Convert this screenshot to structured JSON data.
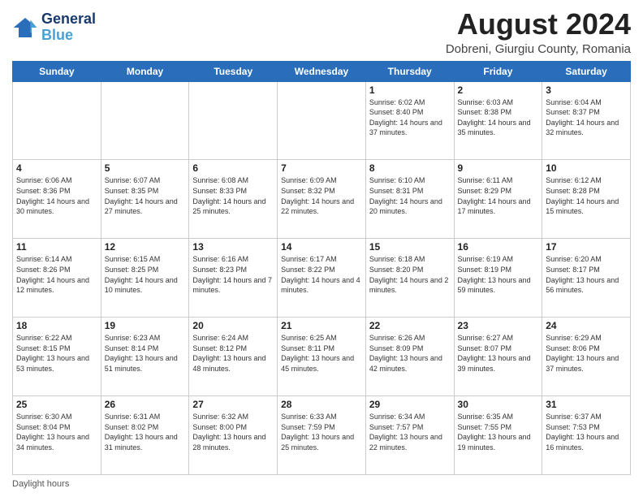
{
  "logo": {
    "line1": "General",
    "line2": "Blue"
  },
  "title": "August 2024",
  "location": "Dobreni, Giurgiu County, Romania",
  "days_of_week": [
    "Sunday",
    "Monday",
    "Tuesday",
    "Wednesday",
    "Thursday",
    "Friday",
    "Saturday"
  ],
  "footer_text": "Daylight hours",
  "weeks": [
    [
      {
        "day": "",
        "info": ""
      },
      {
        "day": "",
        "info": ""
      },
      {
        "day": "",
        "info": ""
      },
      {
        "day": "",
        "info": ""
      },
      {
        "day": "1",
        "info": "Sunrise: 6:02 AM\nSunset: 8:40 PM\nDaylight: 14 hours and 37 minutes."
      },
      {
        "day": "2",
        "info": "Sunrise: 6:03 AM\nSunset: 8:38 PM\nDaylight: 14 hours and 35 minutes."
      },
      {
        "day": "3",
        "info": "Sunrise: 6:04 AM\nSunset: 8:37 PM\nDaylight: 14 hours and 32 minutes."
      }
    ],
    [
      {
        "day": "4",
        "info": "Sunrise: 6:06 AM\nSunset: 8:36 PM\nDaylight: 14 hours and 30 minutes."
      },
      {
        "day": "5",
        "info": "Sunrise: 6:07 AM\nSunset: 8:35 PM\nDaylight: 14 hours and 27 minutes."
      },
      {
        "day": "6",
        "info": "Sunrise: 6:08 AM\nSunset: 8:33 PM\nDaylight: 14 hours and 25 minutes."
      },
      {
        "day": "7",
        "info": "Sunrise: 6:09 AM\nSunset: 8:32 PM\nDaylight: 14 hours and 22 minutes."
      },
      {
        "day": "8",
        "info": "Sunrise: 6:10 AM\nSunset: 8:31 PM\nDaylight: 14 hours and 20 minutes."
      },
      {
        "day": "9",
        "info": "Sunrise: 6:11 AM\nSunset: 8:29 PM\nDaylight: 14 hours and 17 minutes."
      },
      {
        "day": "10",
        "info": "Sunrise: 6:12 AM\nSunset: 8:28 PM\nDaylight: 14 hours and 15 minutes."
      }
    ],
    [
      {
        "day": "11",
        "info": "Sunrise: 6:14 AM\nSunset: 8:26 PM\nDaylight: 14 hours and 12 minutes."
      },
      {
        "day": "12",
        "info": "Sunrise: 6:15 AM\nSunset: 8:25 PM\nDaylight: 14 hours and 10 minutes."
      },
      {
        "day": "13",
        "info": "Sunrise: 6:16 AM\nSunset: 8:23 PM\nDaylight: 14 hours and 7 minutes."
      },
      {
        "day": "14",
        "info": "Sunrise: 6:17 AM\nSunset: 8:22 PM\nDaylight: 14 hours and 4 minutes."
      },
      {
        "day": "15",
        "info": "Sunrise: 6:18 AM\nSunset: 8:20 PM\nDaylight: 14 hours and 2 minutes."
      },
      {
        "day": "16",
        "info": "Sunrise: 6:19 AM\nSunset: 8:19 PM\nDaylight: 13 hours and 59 minutes."
      },
      {
        "day": "17",
        "info": "Sunrise: 6:20 AM\nSunset: 8:17 PM\nDaylight: 13 hours and 56 minutes."
      }
    ],
    [
      {
        "day": "18",
        "info": "Sunrise: 6:22 AM\nSunset: 8:15 PM\nDaylight: 13 hours and 53 minutes."
      },
      {
        "day": "19",
        "info": "Sunrise: 6:23 AM\nSunset: 8:14 PM\nDaylight: 13 hours and 51 minutes."
      },
      {
        "day": "20",
        "info": "Sunrise: 6:24 AM\nSunset: 8:12 PM\nDaylight: 13 hours and 48 minutes."
      },
      {
        "day": "21",
        "info": "Sunrise: 6:25 AM\nSunset: 8:11 PM\nDaylight: 13 hours and 45 minutes."
      },
      {
        "day": "22",
        "info": "Sunrise: 6:26 AM\nSunset: 8:09 PM\nDaylight: 13 hours and 42 minutes."
      },
      {
        "day": "23",
        "info": "Sunrise: 6:27 AM\nSunset: 8:07 PM\nDaylight: 13 hours and 39 minutes."
      },
      {
        "day": "24",
        "info": "Sunrise: 6:29 AM\nSunset: 8:06 PM\nDaylight: 13 hours and 37 minutes."
      }
    ],
    [
      {
        "day": "25",
        "info": "Sunrise: 6:30 AM\nSunset: 8:04 PM\nDaylight: 13 hours and 34 minutes."
      },
      {
        "day": "26",
        "info": "Sunrise: 6:31 AM\nSunset: 8:02 PM\nDaylight: 13 hours and 31 minutes."
      },
      {
        "day": "27",
        "info": "Sunrise: 6:32 AM\nSunset: 8:00 PM\nDaylight: 13 hours and 28 minutes."
      },
      {
        "day": "28",
        "info": "Sunrise: 6:33 AM\nSunset: 7:59 PM\nDaylight: 13 hours and 25 minutes."
      },
      {
        "day": "29",
        "info": "Sunrise: 6:34 AM\nSunset: 7:57 PM\nDaylight: 13 hours and 22 minutes."
      },
      {
        "day": "30",
        "info": "Sunrise: 6:35 AM\nSunset: 7:55 PM\nDaylight: 13 hours and 19 minutes."
      },
      {
        "day": "31",
        "info": "Sunrise: 6:37 AM\nSunset: 7:53 PM\nDaylight: 13 hours and 16 minutes."
      }
    ]
  ]
}
